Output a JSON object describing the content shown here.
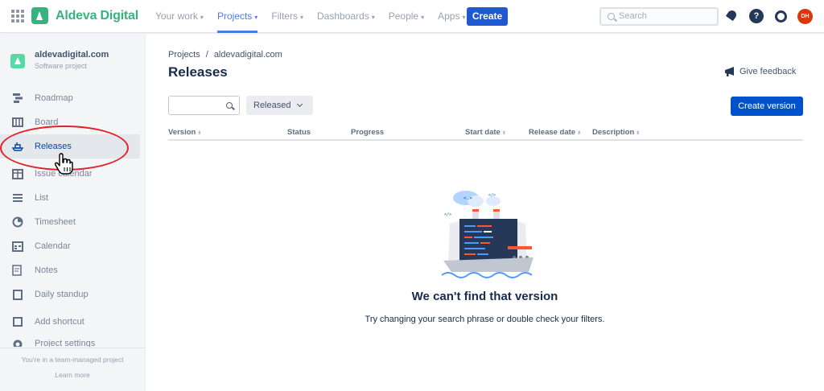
{
  "topnav": {
    "brand": "Aldeva Digital",
    "items": [
      {
        "label": "Your work"
      },
      {
        "label": "Projects"
      },
      {
        "label": "Filters"
      },
      {
        "label": "Dashboards"
      },
      {
        "label": "People"
      },
      {
        "label": "Apps"
      }
    ],
    "active_item": "Projects",
    "create_label": "Create",
    "search_placeholder": "Search",
    "help_glyph": "?",
    "avatar_initials": "DH",
    "icons": [
      "app-switcher-icon",
      "notifications-icon",
      "help-icon",
      "settings-icon"
    ]
  },
  "sidebar": {
    "project_name": "aldevadigital.com",
    "project_type": "Software project",
    "items": [
      {
        "label": "Roadmap",
        "icon": "roadmap-icon"
      },
      {
        "label": "Board",
        "icon": "board-icon"
      },
      {
        "label": "Releases",
        "icon": "ship-icon"
      },
      {
        "label": "Issue calendar",
        "icon": "calendar-grid-icon"
      },
      {
        "label": "List",
        "icon": "list-icon"
      },
      {
        "label": "Timesheet",
        "icon": "pie-icon"
      },
      {
        "label": "Calendar",
        "icon": "calendar-icon"
      },
      {
        "label": "Notes",
        "icon": "notes-icon"
      },
      {
        "label": "Daily standup",
        "icon": "clipboard-icon"
      },
      {
        "label": "Add shortcut",
        "icon": "add-shortcut-icon"
      },
      {
        "label": "Project settings",
        "icon": "settings-icon"
      }
    ],
    "active_item": "Releases",
    "footer_text": "You're in a team-managed project",
    "footer_link": "Learn more"
  },
  "main": {
    "breadcrumb": [
      "Projects",
      "aldevadigital.com"
    ],
    "title": "Releases",
    "feedback_label": "Give feedback",
    "filter_search_value": "",
    "status_filter": "Released",
    "create_version_label": "Create version",
    "columns": [
      "Version",
      "Status",
      "Progress",
      "Start date",
      "Release date",
      "Description"
    ],
    "sortable_columns": [
      "Version",
      "Start date",
      "Release date",
      "Description"
    ],
    "empty_title": "We can't find that version",
    "empty_description": "Try changing your search phrase or double check your filters."
  },
  "colors": {
    "brand_green": "#36b37e",
    "primary_blue": "#0052cc",
    "active_nav": "#4c7de7",
    "annotation_red": "#e0202a",
    "avatar_red": "#de350b"
  }
}
